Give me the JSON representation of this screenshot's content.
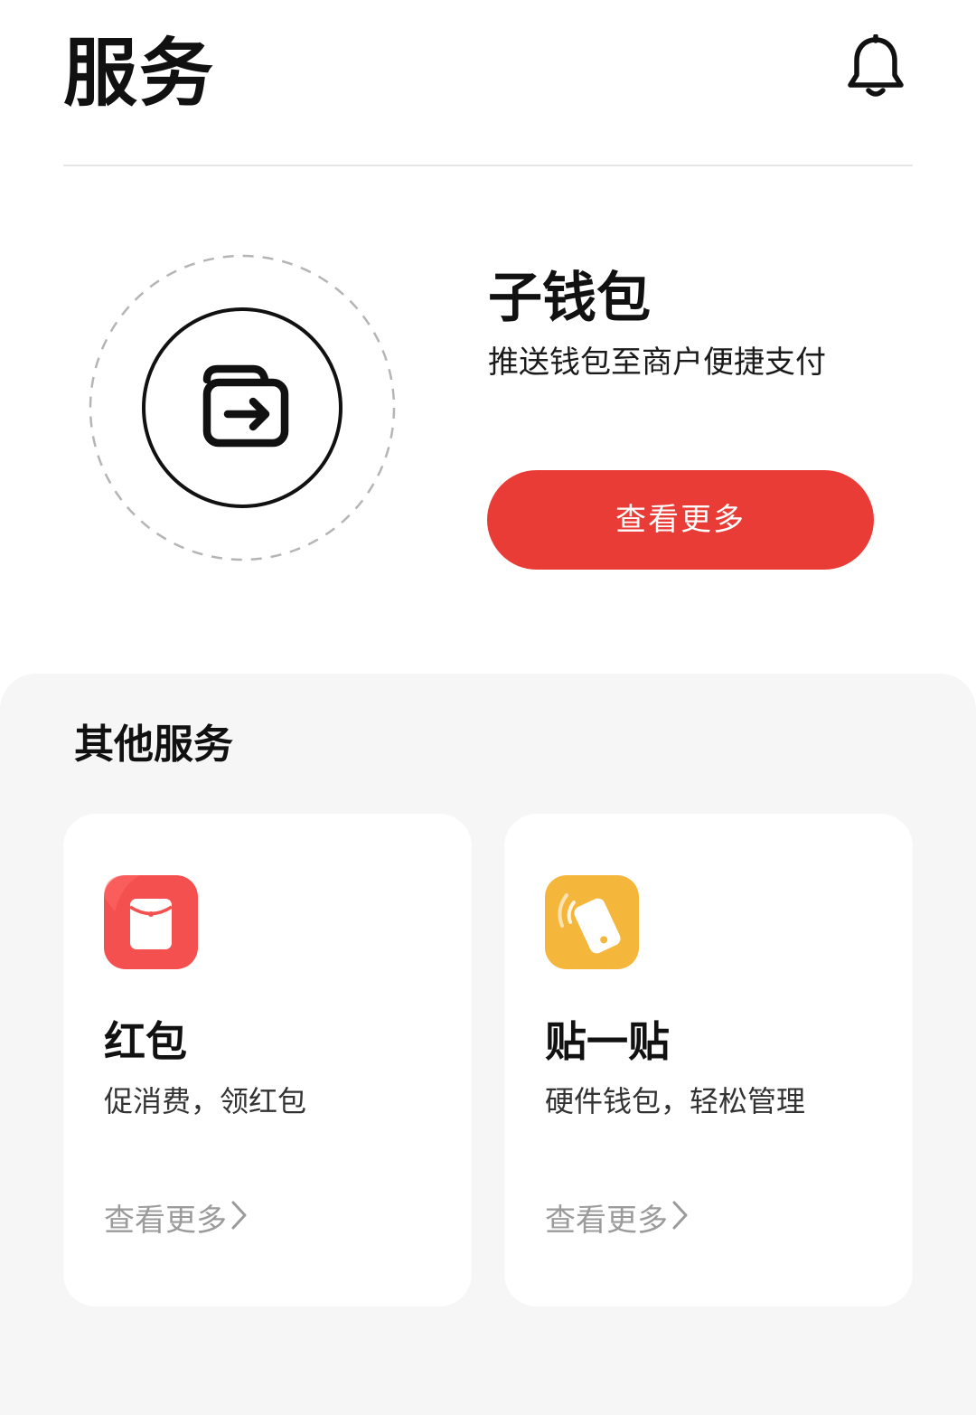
{
  "header": {
    "title": "服务",
    "bell_icon": "bell-icon"
  },
  "hero": {
    "icon": "wallet-push-icon",
    "title": "子钱包",
    "subtitle": "推送钱包至商户便捷支付",
    "button_label": "查看更多"
  },
  "other_services": {
    "title": "其他服务",
    "cards": [
      {
        "icon": "red-envelope-icon",
        "icon_color": "#f4504f",
        "title": "红包",
        "description": "促消费，领红包",
        "more_label": "查看更多"
      },
      {
        "icon": "tap-phone-icon",
        "icon_color": "#f5b73b",
        "title": "贴一贴",
        "description": "硬件钱包，轻松管理",
        "more_label": "查看更多"
      }
    ]
  },
  "colors": {
    "accent": "#ea3c37",
    "panel_bg": "#f6f6f6",
    "muted_text": "#9b9b9b"
  }
}
